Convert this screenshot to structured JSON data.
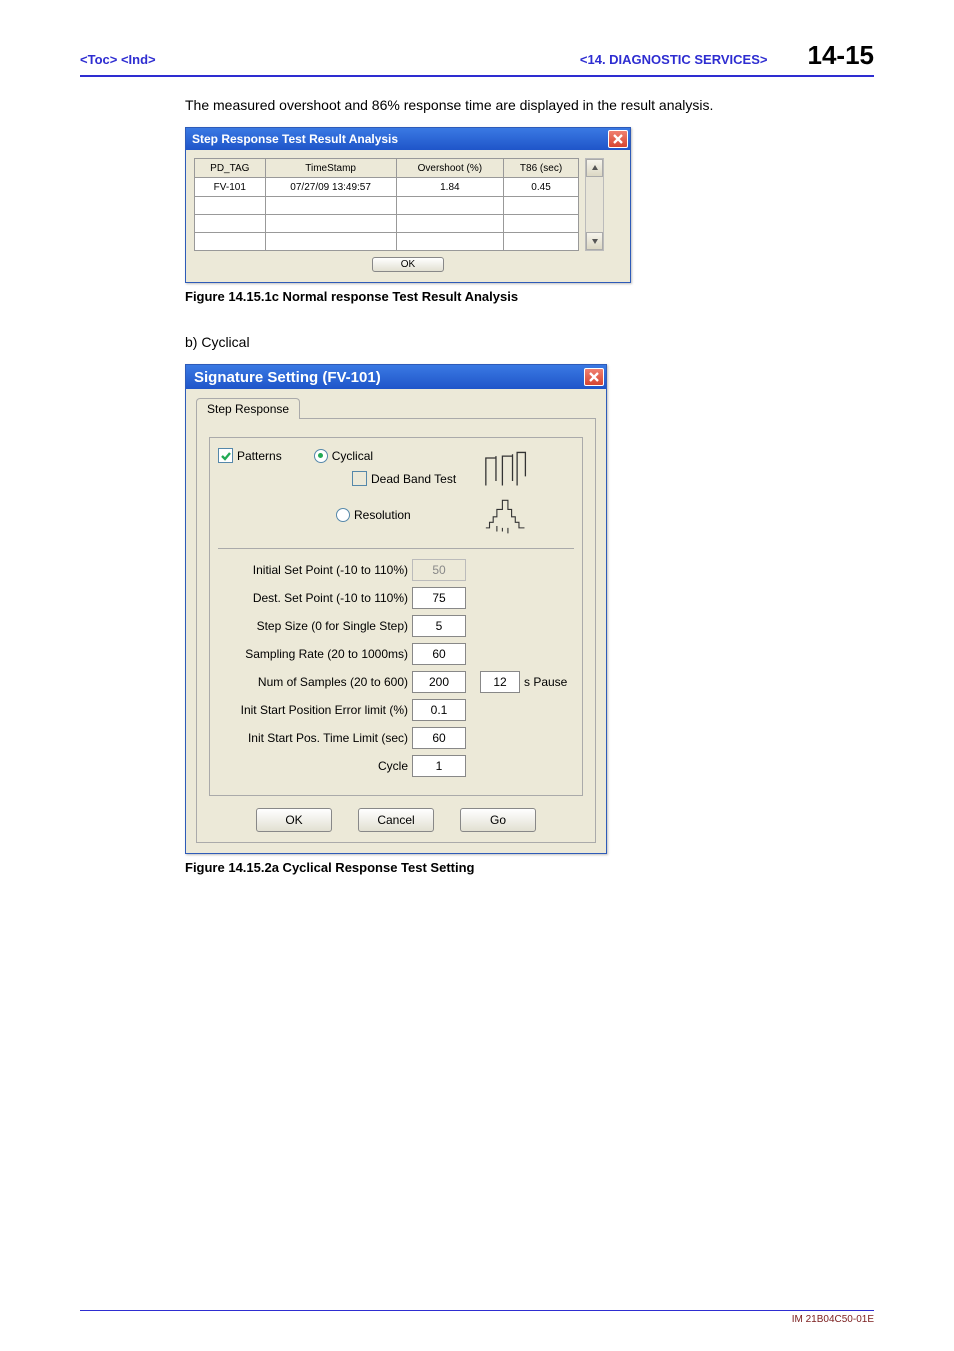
{
  "header": {
    "toc": "<Toc>",
    "ind": "<Ind>",
    "section": "<14.  DIAGNOSTIC SERVICES>",
    "page": "14-15"
  },
  "body": {
    "intro": "The measured overshoot and 86% response time are displayed in the result analysis.",
    "figcap1": "Figure  14.15.1c   Normal response Test Result Analysis",
    "subhead": "b)     Cyclical",
    "figcap2": "Figure 14.15.2a   Cyclical Response Test Setting"
  },
  "win1": {
    "title": "Step Response Test Result Analysis",
    "cols": [
      "PD_TAG",
      "TimeStamp",
      "Overshoot (%)",
      "T86 (sec)"
    ],
    "rows": [
      [
        "FV-101",
        "07/27/09 13:49:57",
        "1.84",
        "0.45"
      ]
    ],
    "ok": "OK"
  },
  "win2": {
    "title": "Signature Setting (FV-101)",
    "tab": "Step Response",
    "patterns_label": "Patterns",
    "cyclical_label": "Cyclical",
    "deadband_label": "Dead Band Test",
    "resolution_label": "Resolution",
    "fields": {
      "initial_sp": {
        "label": "Initial Set Point (-10 to 110%)",
        "value": "50",
        "disabled": true
      },
      "dest_sp": {
        "label": "Dest. Set Point (-10 to 110%)",
        "value": "75"
      },
      "step_size": {
        "label": "Step Size (0 for Single Step)",
        "value": "5"
      },
      "sampling": {
        "label": "Sampling Rate (20 to 1000ms)",
        "value": "60"
      },
      "num_samples": {
        "label": "Num of Samples (20 to 600)",
        "value": "200",
        "after_value": "12",
        "unit": "s  Pause"
      },
      "err_limit": {
        "label": "Init Start Position Error limit (%)",
        "value": "0.1"
      },
      "time_limit": {
        "label": "Init Start Pos. Time Limit (sec)",
        "value": "60"
      },
      "cycle": {
        "label": "Cycle",
        "value": "1"
      }
    },
    "buttons": {
      "ok": "OK",
      "cancel": "Cancel",
      "go": "Go"
    }
  },
  "footer": "IM 21B04C50-01E"
}
